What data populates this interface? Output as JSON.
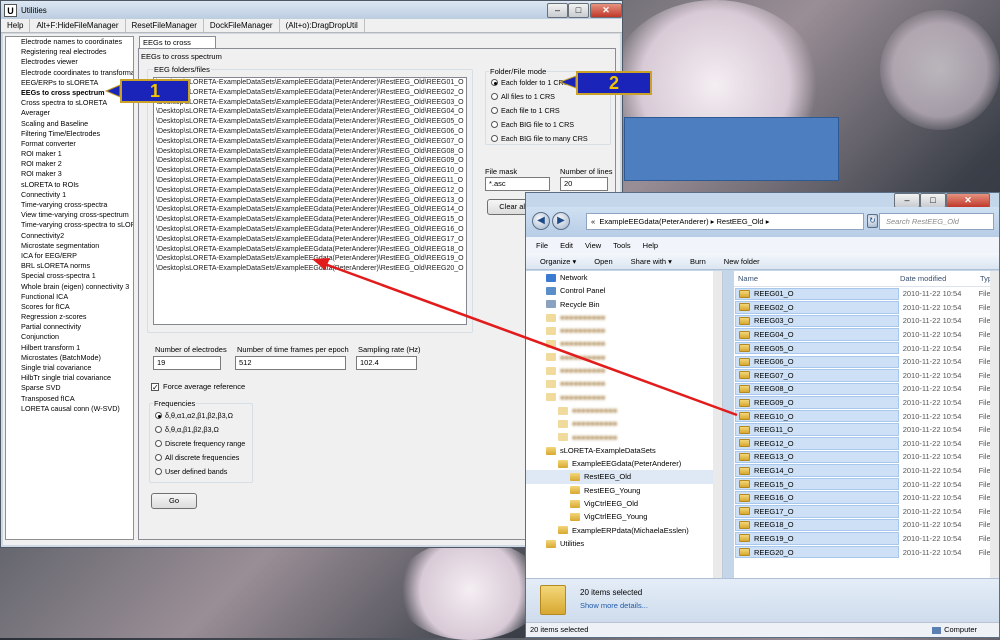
{
  "utilities": {
    "title": "Utilities",
    "menu": [
      "Help",
      "Alt+F:HideFileManager",
      "ResetFileManager",
      "DockFileManager",
      "(Alt+o):DragDropUtil"
    ],
    "nav_items": [
      "Electrode names to coordinates",
      "Registering real electrodes",
      "Electrodes viewer",
      "Electrode coordinates to transforma",
      "EEG/ERPs to sLORETA",
      "EEGs to cross spectrum",
      "Cross spectra to sLORETA",
      "Averager",
      "Scaling and Baseline",
      "Filtering Time/Electrodes",
      "Format converter",
      "ROI maker 1",
      "ROI maker 2",
      "ROI maker 3",
      "sLORETA to ROIs",
      "Connectivity 1",
      "Time-varying cross-spectra",
      "View time-varying cross-spectrum",
      "Time-varying cross-spectra to sLOR",
      "Connectivity2",
      "Microstate segmentation",
      "ICA for EEG/ERP",
      "BRL sLORETA norms",
      "Special cross-spectra 1",
      "Whole brain (eigen) connectivity 3",
      "Functional ICA",
      "Scores for fICA",
      "Regression z-scores",
      "Partial connectivity",
      "Conjunction",
      "Hilbert transform 1",
      "Microstates (BatchMode)",
      "Single trial covariance",
      "HilbTr single trial covariance",
      "Sparse SVD",
      "Transposed fICA",
      "LORETA causal conn (W-SVD)"
    ],
    "selected_index": 5,
    "tab_label": "EEGs to cross spectrum",
    "group_title": "EEGs to cross spectrum",
    "files_label": "EEG folders/files",
    "files": [
      "\\Desktop\\sLORETA-ExampleDataSets\\ExampleEEGdata(PeterAnderer)\\RestEEG_Old\\REEG01_O",
      "\\Desktop\\sLORETA-ExampleDataSets\\ExampleEEGdata(PeterAnderer)\\RestEEG_Old\\REEG02_O",
      "\\Desktop\\sLORETA-ExampleDataSets\\ExampleEEGdata(PeterAnderer)\\RestEEG_Old\\REEG03_O",
      "\\Desktop\\sLORETA-ExampleDataSets\\ExampleEEGdata(PeterAnderer)\\RestEEG_Old\\REEG04_O",
      "\\Desktop\\sLORETA-ExampleDataSets\\ExampleEEGdata(PeterAnderer)\\RestEEG_Old\\REEG05_O",
      "\\Desktop\\sLORETA-ExampleDataSets\\ExampleEEGdata(PeterAnderer)\\RestEEG_Old\\REEG06_O",
      "\\Desktop\\sLORETA-ExampleDataSets\\ExampleEEGdata(PeterAnderer)\\RestEEG_Old\\REEG07_O",
      "\\Desktop\\sLORETA-ExampleDataSets\\ExampleEEGdata(PeterAnderer)\\RestEEG_Old\\REEG08_O",
      "\\Desktop\\sLORETA-ExampleDataSets\\ExampleEEGdata(PeterAnderer)\\RestEEG_Old\\REEG09_O",
      "\\Desktop\\sLORETA-ExampleDataSets\\ExampleEEGdata(PeterAnderer)\\RestEEG_Old\\REEG10_O",
      "\\Desktop\\sLORETA-ExampleDataSets\\ExampleEEGdata(PeterAnderer)\\RestEEG_Old\\REEG11_O",
      "\\Desktop\\sLORETA-ExampleDataSets\\ExampleEEGdata(PeterAnderer)\\RestEEG_Old\\REEG12_O",
      "\\Desktop\\sLORETA-ExampleDataSets\\ExampleEEGdata(PeterAnderer)\\RestEEG_Old\\REEG13_O",
      "\\Desktop\\sLORETA-ExampleDataSets\\ExampleEEGdata(PeterAnderer)\\RestEEG_Old\\REEG14_O",
      "\\Desktop\\sLORETA-ExampleDataSets\\ExampleEEGdata(PeterAnderer)\\RestEEG_Old\\REEG15_O",
      "\\Desktop\\sLORETA-ExampleDataSets\\ExampleEEGdata(PeterAnderer)\\RestEEG_Old\\REEG16_O",
      "\\Desktop\\sLORETA-ExampleDataSets\\ExampleEEGdata(PeterAnderer)\\RestEEG_Old\\REEG17_O",
      "\\Desktop\\sLORETA-ExampleDataSets\\ExampleEEGdata(PeterAnderer)\\RestEEG_Old\\REEG18_O",
      "\\Desktop\\sLORETA-ExampleDataSets\\ExampleEEGdata(PeterAnderer)\\RestEEG_Old\\REEG19_O",
      "\\Desktop\\sLORETA-ExampleDataSets\\ExampleEEGdata(PeterAnderer)\\RestEEG_Old\\REEG20_O"
    ],
    "folder_mode_title": "Folder/File mode",
    "folder_modes": [
      "Each folder to 1 CRS",
      "All files to 1 CRS",
      "Each file to 1 CRS",
      "Each BIG file to 1 CRS",
      "Each BIG file to many CRS"
    ],
    "folder_mode_selected": 0,
    "file_mask_label": "File mask",
    "file_mask_value": "*.asc",
    "num_lines_label": "Number of lines",
    "num_lines_value": "20",
    "clear_button": "Clear all",
    "electrodes_label": "Number of electrodes",
    "electrodes_value": "19",
    "timeframes_label": "Number of time frames per epoch",
    "timeframes_value": "512",
    "sampling_label": "Sampling rate (Hz)",
    "sampling_value": "102.4",
    "force_avg_label": "Force average reference",
    "force_avg_checked": true,
    "freq_title": "Frequencies",
    "freq_options": [
      "δ,θ,α1,α2,β1,β2,β3,Ω",
      "δ,θ,α,β1,β2,β3,Ω",
      "Discrete frequency range",
      "All discrete frequencies",
      "User defined bands"
    ],
    "freq_selected": 0,
    "go_button": "Go"
  },
  "callouts": [
    "1",
    "2"
  ],
  "explorer": {
    "breadcrumb": [
      "«",
      "ExampleEEGdata(PeterAnderer)",
      "RestEEG_Old"
    ],
    "search_placeholder": "Search RestEEG_Old",
    "menu": [
      "File",
      "Edit",
      "View",
      "Tools",
      "Help"
    ],
    "toolbar": [
      "Organize ▾",
      "Open",
      "Share with ▾",
      "Burn",
      "New folder"
    ],
    "tree_top": [
      "Network",
      "Control Panel",
      "Recycle Bin"
    ],
    "tree_bottom": [
      "sLORETA-ExampleDataSets",
      "ExampleEEGdata(PeterAnderer)",
      "RestEEG_Old",
      "RestEEG_Young",
      "VigCtrlEEG_Old",
      "VigCtrlEEG_Young",
      "ExampleERPdata(MichaelaEsslen)",
      "Utilities"
    ],
    "columns": [
      "Name",
      "Date modified",
      "Type"
    ],
    "folders": [
      "REEG01_O",
      "REEG02_O",
      "REEG03_O",
      "REEG04_O",
      "REEG05_O",
      "REEG06_O",
      "REEG07_O",
      "REEG08_O",
      "REEG09_O",
      "REEG10_O",
      "REEG11_O",
      "REEG12_O",
      "REEG13_O",
      "REEG14_O",
      "REEG15_O",
      "REEG16_O",
      "REEG17_O",
      "REEG18_O",
      "REEG19_O",
      "REEG20_O"
    ],
    "date": "2010-11-22 10:54",
    "type": "File fo",
    "details_count": "20 items selected",
    "details_more": "Show more details...",
    "status_left": "20 items selected",
    "status_right": "Computer"
  }
}
